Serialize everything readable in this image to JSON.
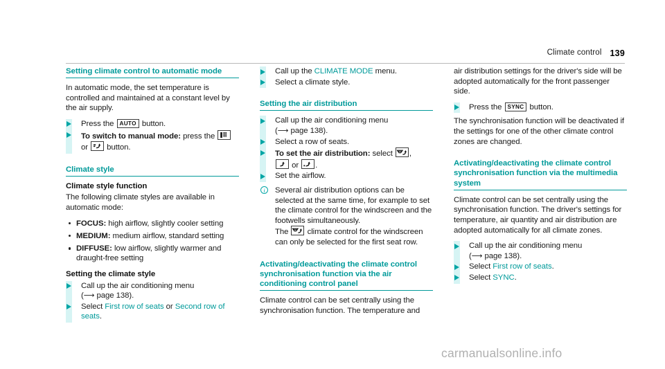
{
  "header": {
    "title": "Climate control",
    "page_number": "139"
  },
  "watermark": "carmanualsonline.info",
  "colors": {
    "teal": "#009a9a",
    "arrow_teal": "#00a5a5",
    "band": "#d6f4f4",
    "text": "#1a1a1a",
    "watermark": "#b0b0b0"
  },
  "icons": {
    "auto_button": "auto-button-keycap",
    "manual_button": "air-quantity-button-icon",
    "airflow_button": "air-distribution-button-icon",
    "sync_button": "sync-button-keycap",
    "windscreen_distribution": "windscreen-air-distribution-icon",
    "upper_body_distribution": "upper-body-air-distribution-icon",
    "footwell_distribution": "footwell-air-distribution-icon",
    "info": "info-circle-icon",
    "step_marker": "triangle-right-icon",
    "bullet_marker": "round-bullet-icon",
    "page_reference_arrow": "right-arrow-icon"
  },
  "col1": {
    "heading1": "Setting climate control to automatic mode",
    "para1": "In automatic mode, the set temperature is controlled and maintained at a constant level by the air supply.",
    "step1_pre": "Press the",
    "step1_post": "button.",
    "step2_bold": "To switch to manual mode:",
    "step2_mid": "press the",
    "step2_or": "or",
    "step2_post": "button.",
    "heading2": "Climate style",
    "heading3": "Climate style function",
    "para2": "The following climate styles are available in automatic mode:",
    "styles": [
      {
        "name": "FOCUS:",
        "desc": "high airflow, slightly cooler setting"
      },
      {
        "name": "MEDIUM:",
        "desc": "medium airflow, standard setting"
      },
      {
        "name": "DIFFUSE:",
        "desc": "low airflow, slightly warmer and draught-free setting"
      }
    ],
    "heading4": "Setting the climate style",
    "step3_line1": "Call up the air conditioning menu",
    "step3_line2_pre": "(",
    "step3_line2_page": "page 138).",
    "step4_pre": "Select",
    "step4_link1": "First row of seats",
    "step4_or": "or",
    "step4_link2": "Second row of seats",
    "step4_post": "."
  },
  "col2": {
    "step1_pre": "Call up the",
    "step1_link": "CLIMATE MODE",
    "step1_post": "menu.",
    "step2": "Select a climate style.",
    "heading1": "Setting the air distribution",
    "step3_line1": "Call up the air conditioning menu",
    "step3_line2_page": "page 138).",
    "step4": "Select a row of seats.",
    "step5_bold": "To set the air distribution:",
    "step5_mid": "select",
    "step5_or": "or",
    "step5_post": ".",
    "step6": "Set the airflow.",
    "note_part1": "Several air distribution options can be selected at the same time, for example to set the climate control for the windscreen and the footwells simultaneously.",
    "note_part2_pre": "The",
    "note_part2_post": "climate control for the windscreen can only be selected for the first seat row.",
    "heading2": "Activating/deactivating the climate control synchronisation function via the air conditioning control panel",
    "para1": "Climate control can be set centrally using the synchronisation function. The temperature and"
  },
  "col3": {
    "para1": "air distribution settings for the driver's side will be adopted automatically for the front passenger side.",
    "step1_pre": "Press the",
    "step1_post": "button.",
    "para2": "The synchronisation function will be deactivated if the settings for one of the other climate control zones are changed.",
    "heading1": "Activating/deactivating the climate control synchronisation function via the multimedia system",
    "para3": "Climate control can be set centrally using the synchronisation function. The driver's settings for temperature, air quantity and air distribution are adopted automatically for all climate zones.",
    "step2_line1": "Call up the air conditioning menu",
    "step2_line2_page": "page 138).",
    "step3_pre": "Select",
    "step3_link": "First row of seats",
    "step3_post": ".",
    "step4_pre": "Select",
    "step4_link": "SYNC",
    "step4_post": "."
  }
}
